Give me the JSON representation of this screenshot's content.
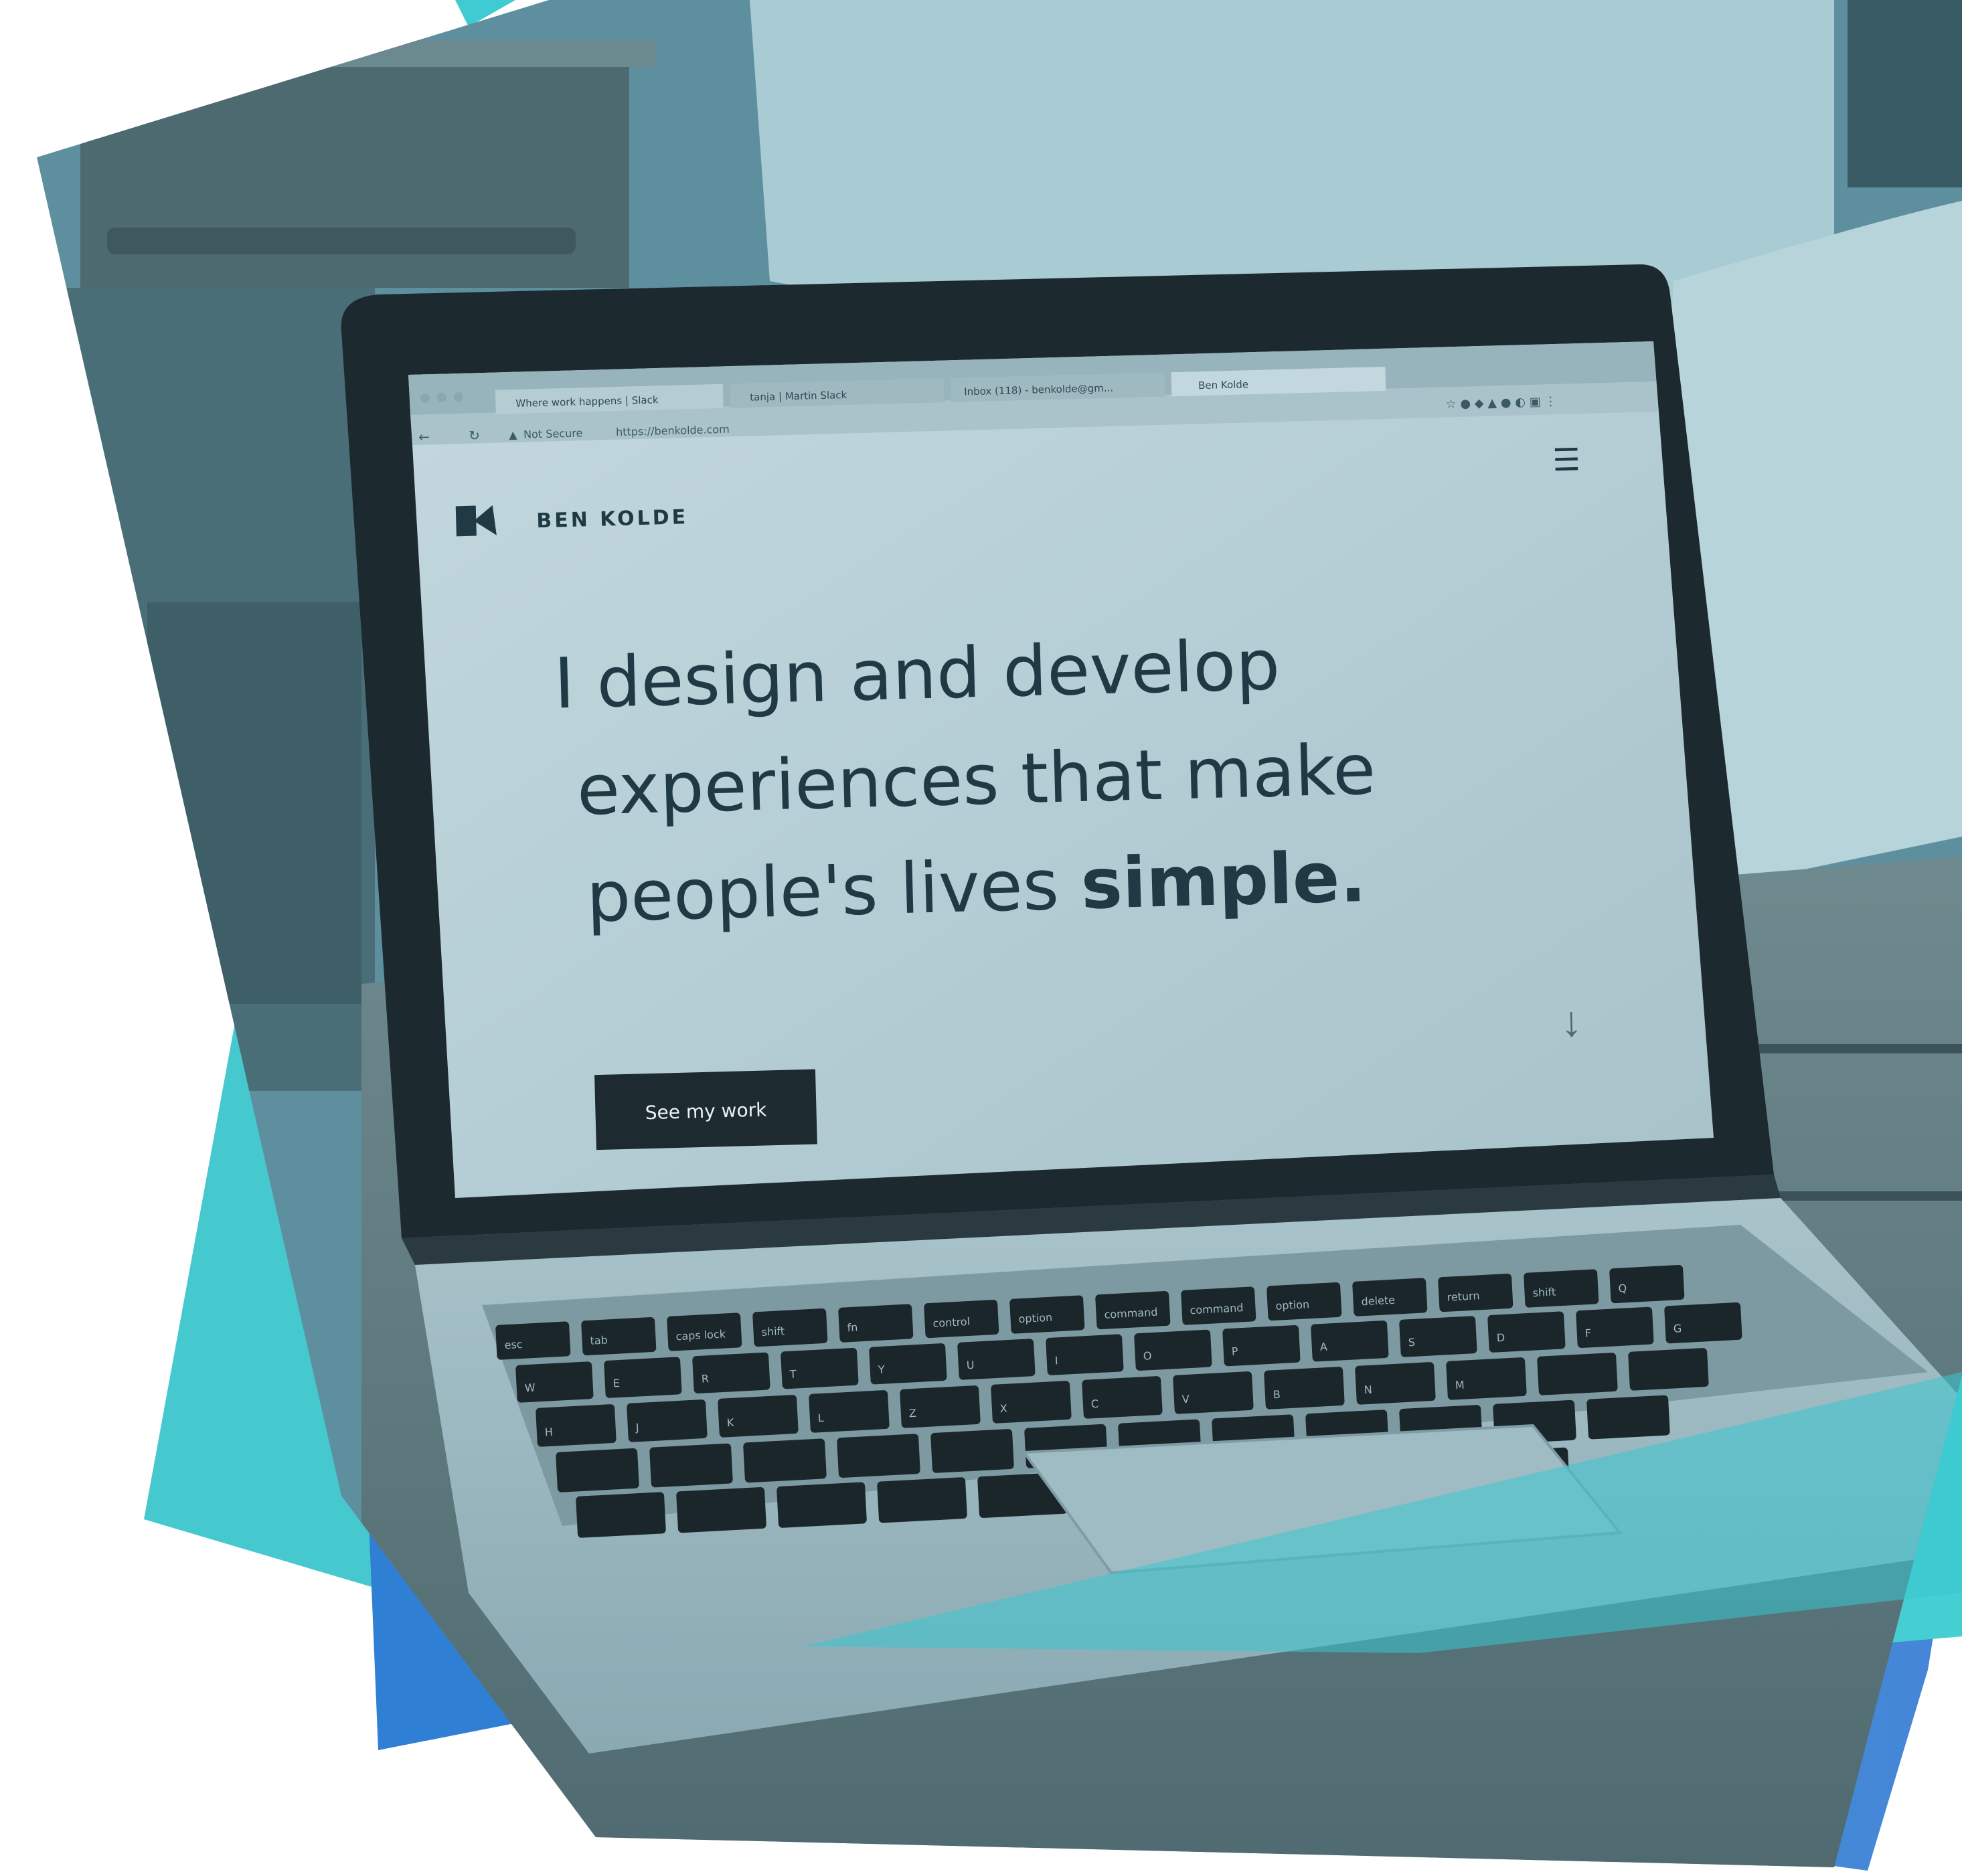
{
  "palette": {
    "teal": "#3ecbd1",
    "blue": "#2f7fd4",
    "mid_blue": "#4a8fd8",
    "photo_tint": "#5b8ea0",
    "screen_bg": "#b9d0d7",
    "screen_text": "#1f3a44",
    "button_bg": "#1d2b30",
    "button_text": "#e8f2f4",
    "keyboard_key": "#1b262b"
  },
  "browser": {
    "tabs": [
      {
        "label": "Where work happens | Slack"
      },
      {
        "label": "tanja | Martin Slack"
      },
      {
        "label": "Inbox (118) - benkolde@gm..."
      },
      {
        "label": "Ben Kolde"
      }
    ],
    "security_label": "Not Secure",
    "url": "https://benkolde.com"
  },
  "website": {
    "brand_name": "BEN KOLDE",
    "headline_line1": "I design and develop",
    "headline_line2": "experiences that make",
    "headline_line3_regular": "people's lives ",
    "headline_line3_bold": "simple.",
    "cta_label": "See my work"
  },
  "keyboard": {
    "keys": [
      "esc",
      "tab",
      "caps lock",
      "shift",
      "fn",
      "control",
      "option",
      "command",
      "command",
      "option",
      "delete",
      "return",
      "shift",
      "Q",
      "W",
      "E",
      "R",
      "T",
      "Y",
      "U",
      "I",
      "O",
      "P",
      "A",
      "S",
      "D",
      "F",
      "G",
      "H",
      "J",
      "K",
      "L",
      "Z",
      "X",
      "C",
      "V",
      "B",
      "N",
      "M"
    ]
  }
}
